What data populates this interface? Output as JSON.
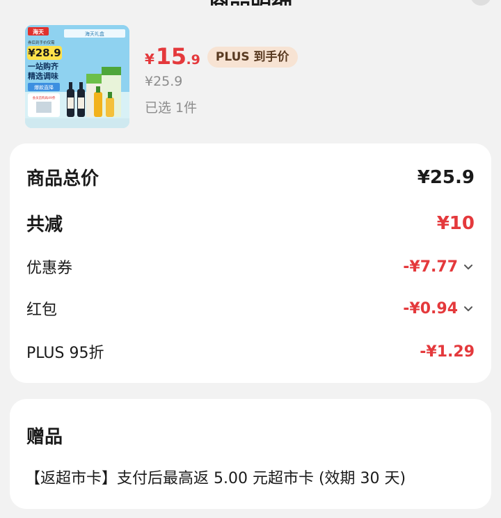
{
  "header": {
    "title": "商品明细"
  },
  "product": {
    "thumbnail": {
      "brand": "海天",
      "banner_text": "海天礼盒",
      "promo_small": "券后到手价仅需",
      "promo_price": "¥28.9",
      "slogan_1": "一站购齐",
      "slogan_2": "精选调味",
      "tag": "爆款直降",
      "member_tag": "会员首购再49券"
    },
    "price": {
      "yen": "¥",
      "integer": "15",
      "decimal": ".9"
    },
    "plus_badge": "PLUS 到手价",
    "original_price": "¥25.9",
    "selected_count": "已选 1件"
  },
  "summary": {
    "total_label": "商品总价",
    "total_value": "¥25.9",
    "discount_label": "共减",
    "discount_value": "¥10",
    "coupon_label": "优惠券",
    "coupon_value": "-¥7.77",
    "redpacket_label": "红包",
    "redpacket_value": "-¥0.94",
    "plus_label": "PLUS 95折",
    "plus_value": "-¥1.29"
  },
  "gift": {
    "title": "赠品",
    "text": "【返超市卡】支付后最高返 5.00 元超市卡 (效期 30 天)"
  },
  "colors": {
    "accent_red": "#e4393c",
    "badge_bg": "#f7e3d3",
    "page_bg": "#f2f2f2"
  }
}
